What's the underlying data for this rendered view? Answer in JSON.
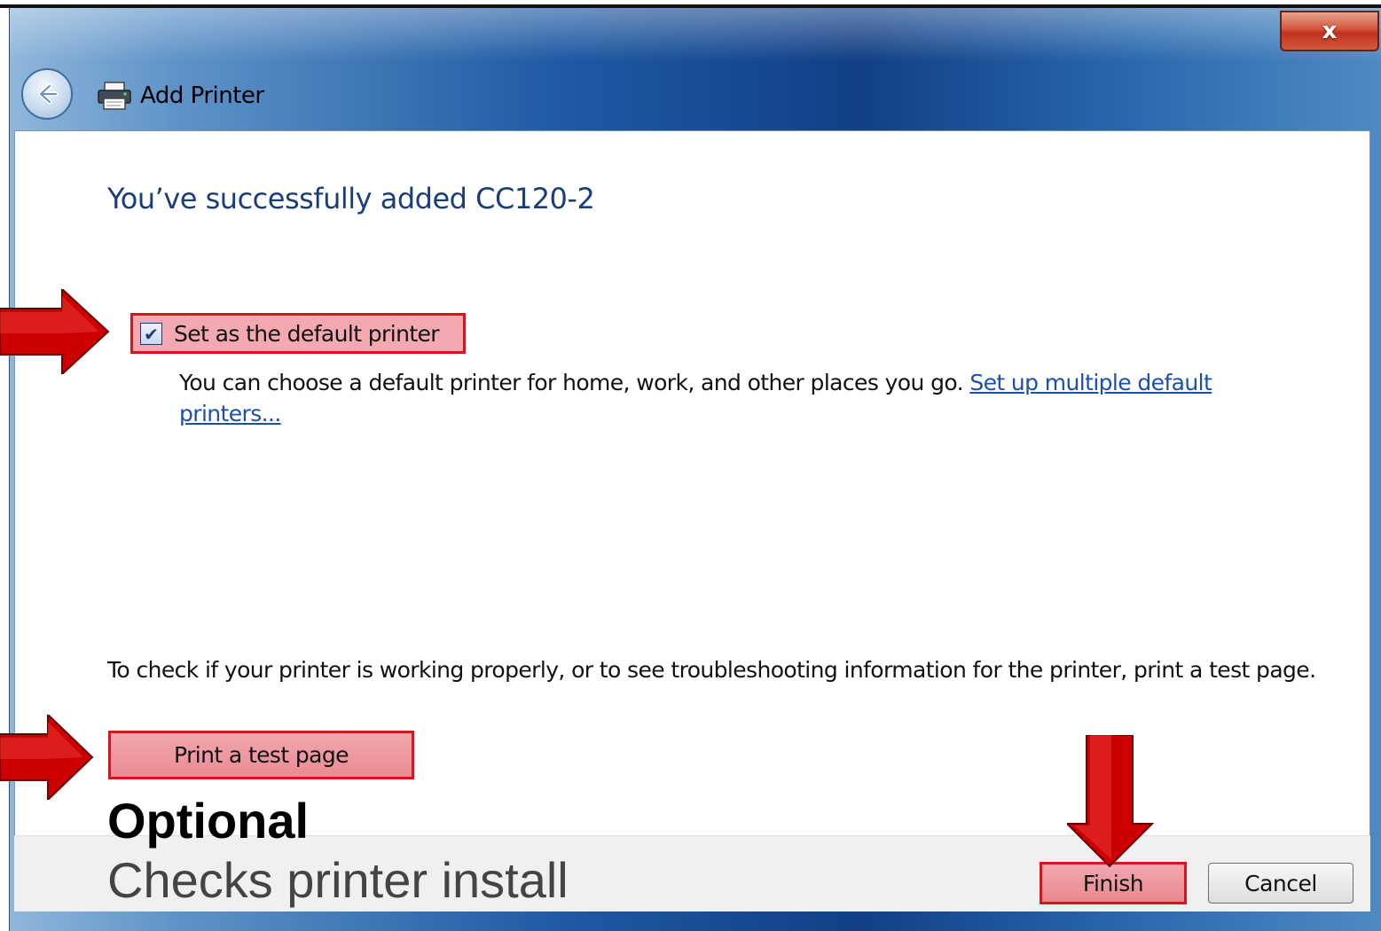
{
  "window": {
    "title": "Add Printer",
    "close_label": "x"
  },
  "main": {
    "heading": "You’ve successfully added CC120-2",
    "default_checkbox": {
      "label": "Set as the default printer",
      "checked": true,
      "check_glyph": "✔"
    },
    "info_text": "You can choose a default printer for home, work, and other places you go.",
    "info_link": "Set up multiple default printers...",
    "test_text": "To check if your printer is working properly, or to see troubleshooting information for the printer, print a test page.",
    "test_button": "Print a test page"
  },
  "annotation": {
    "optional": "Optional",
    "caption": "Checks printer install",
    "arrow_color": "#cc0000",
    "highlight_color": "#d8141f"
  },
  "footer": {
    "finish_label": "Finish",
    "cancel_label": "Cancel"
  },
  "icons": [
    "back-arrow-icon",
    "printer-icon",
    "close-icon",
    "checkmark-icon",
    "red-arrow-icon"
  ]
}
